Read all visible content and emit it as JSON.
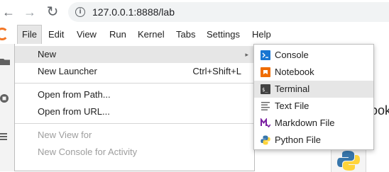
{
  "browser": {
    "url": "127.0.0.1:8888/lab",
    "back_icon": "←",
    "forward_icon": "→",
    "reload_icon": "↻",
    "info_icon": "i"
  },
  "menubar": {
    "items": [
      "File",
      "Edit",
      "View",
      "Run",
      "Kernel",
      "Tabs",
      "Settings",
      "Help"
    ],
    "active": "File"
  },
  "file_menu": {
    "items": [
      {
        "label": "New",
        "shortcut": "",
        "submenu_arrow": "▸",
        "state": "hover"
      },
      {
        "label": "New Launcher",
        "shortcut": "Ctrl+Shift+L",
        "state": "normal"
      },
      {
        "label": "Open from Path...",
        "shortcut": "",
        "state": "normal"
      },
      {
        "label": "Open from URL...",
        "shortcut": "",
        "state": "normal"
      },
      {
        "label": "New View for",
        "shortcut": "",
        "state": "disabled"
      },
      {
        "label": "New Console for Activity",
        "shortcut": "",
        "state": "disabled"
      }
    ]
  },
  "new_submenu": {
    "items": [
      {
        "label": "Console",
        "icon": "console-icon"
      },
      {
        "label": "Notebook",
        "icon": "notebook-icon"
      },
      {
        "label": "Terminal",
        "icon": "terminal-icon"
      },
      {
        "label": "Text File",
        "icon": "text-file-icon"
      },
      {
        "label": "Markdown File",
        "icon": "markdown-icon"
      },
      {
        "label": "Python File",
        "icon": "python-icon"
      }
    ],
    "hovered": "Terminal"
  },
  "background": {
    "partial_text": "ook"
  },
  "colors": {
    "jupyter_orange": "#f37726",
    "console_blue": "#1976d2",
    "notebook_orange": "#ef6c00",
    "markdown_purple": "#7b1fa2",
    "python_blue": "#3776ab",
    "python_yellow": "#ffd43b",
    "hover_grey": "#e6e6e6"
  }
}
